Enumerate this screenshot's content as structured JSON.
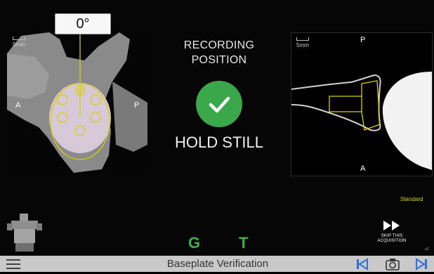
{
  "angle": {
    "value": "0°"
  },
  "left_view": {
    "scale_label": "5mm",
    "left_label": "A",
    "right_label": "P"
  },
  "status": {
    "recording": "RECORDING POSITION",
    "instruction": "HOLD STILL"
  },
  "right_view": {
    "scale_label": "5mm",
    "top_label": "P",
    "bottom_label": "A"
  },
  "mode": {
    "label": "Standard"
  },
  "gt": {
    "g": "G",
    "t": "T"
  },
  "skip": {
    "line1": "SKIP THIS",
    "line2": "ACQUISITION"
  },
  "version": {
    "label": "v2."
  },
  "bottom_bar": {
    "title": "Baseplate Verification"
  },
  "colors": {
    "accent_green": "#3aa84a",
    "highlight_yellow": "#d8d000",
    "bar_gray": "#c9c9c9"
  }
}
